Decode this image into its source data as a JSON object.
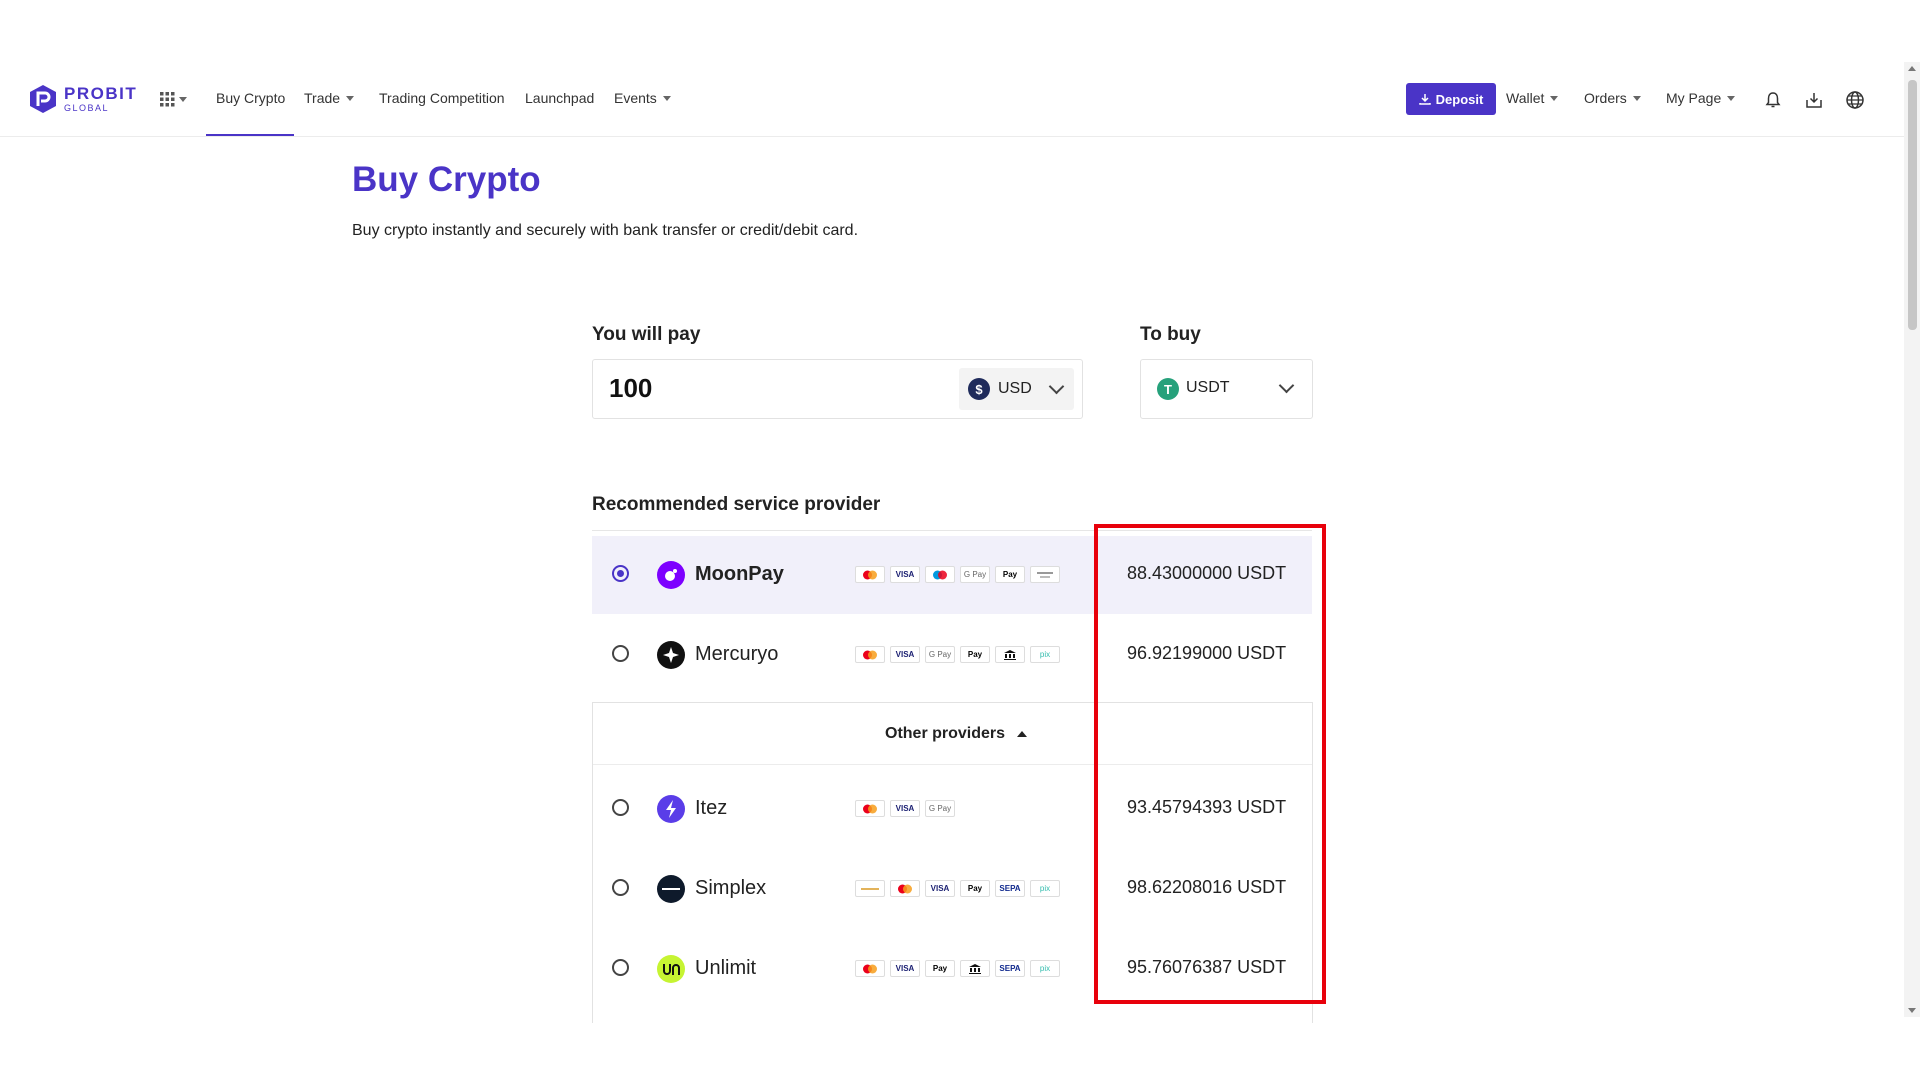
{
  "brand": {
    "name": "PROBIT",
    "sub": "GLOBAL",
    "accent": "#4a34c7"
  },
  "nav": {
    "items": [
      "Buy Crypto",
      "Trade",
      "Trading Competition",
      "Launchpad",
      "Events"
    ],
    "deposit": "Deposit",
    "right_items": [
      "Wallet",
      "Orders",
      "My Page"
    ],
    "icons": [
      "bell-icon",
      "download-icon",
      "globe-icon"
    ]
  },
  "page": {
    "title": "Buy Crypto",
    "subtitle": "Buy crypto instantly and securely with bank transfer or credit/debit card."
  },
  "form": {
    "pay_label": "You will pay",
    "pay_value": "100",
    "pay_currency": "USD",
    "buy_label": "To buy",
    "buy_currency": "USDT"
  },
  "providers": {
    "recommended_label": "Recommended service provider",
    "other_label": "Other providers",
    "recommended": [
      {
        "name": "MoonPay",
        "amount": "88.43000000 USDT",
        "selected": true
      },
      {
        "name": "Mercuryo",
        "amount": "96.92199000 USDT",
        "selected": false
      }
    ],
    "other": [
      {
        "name": "Itez",
        "amount": "93.45794393 USDT"
      },
      {
        "name": "Simplex",
        "amount": "98.62208016 USDT"
      },
      {
        "name": "Unlimit",
        "amount": "95.76076387 USDT"
      }
    ]
  },
  "payment_marks": {
    "visa": "VISA",
    "gpay": "G Pay",
    "apay": "Pay",
    "sepa": "SEPA",
    "pix": "pix"
  },
  "colors": {
    "highlight": "#e8000b",
    "selected_row": "#f1f0fa"
  }
}
